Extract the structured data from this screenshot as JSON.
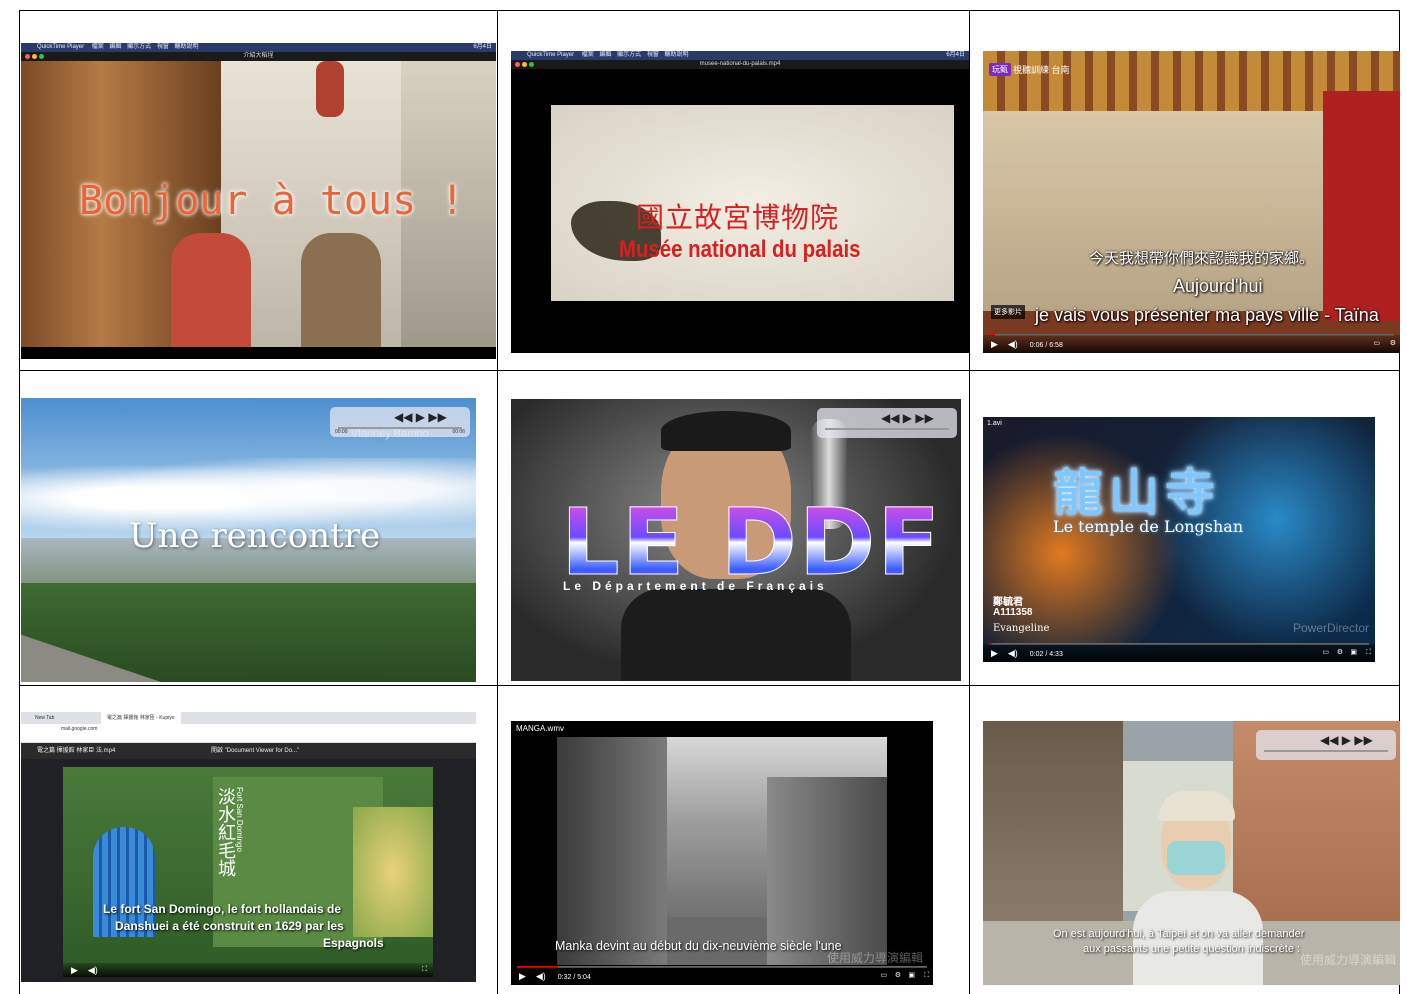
{
  "cells": [
    {
      "id": "bonjour",
      "app_title": "QuickTime Player",
      "window_title": "介紹大稻埕",
      "menu_items": [
        "檔案",
        "編輯",
        "顯示方式",
        "視窗",
        "輔助說明"
      ],
      "clock": "6月4日",
      "overlay_title": "Bonjour à tous !"
    },
    {
      "id": "palais",
      "app_title": "QuickTime Player",
      "window_title": "musee-national-du-palais.mp4",
      "menu_items": [
        "檔案",
        "編輯",
        "顯示方式",
        "視窗",
        "輔助說明"
      ],
      "clock": "6月4日",
      "title_zh": "國立故宮博物院",
      "title_fr": "Musée national du palais"
    },
    {
      "id": "tainan",
      "channel_badge": "玩甄",
      "channel_title": "視聽訓練 台南",
      "subtitle_zh": "今天我想帶你們來認識我的家鄉。",
      "subtitle_fr_1": "Aujourd'hui",
      "subtitle_fr_2": "je vais vous présenter ma pays ville - Taïna",
      "more_videos": "更多影片",
      "time": "0:06 / 6:58",
      "progress": 0.015
    },
    {
      "id": "rencontre",
      "title": "Une rencontre",
      "watermark": "Vlanney Bambo",
      "time_left": "00:00",
      "time_right": "00:06",
      "progress": 0.0
    },
    {
      "id": "ddf",
      "title": "LE DDF",
      "subtitle": "Le Département de Français"
    },
    {
      "id": "longshan",
      "file_label": "1.avi",
      "title_zh": "龍山寺",
      "title_fr": "Le temple de Longshan",
      "credit_1": "鄭毓君",
      "credit_2": "A111358",
      "credit_3": "Evangeline",
      "watermark": "PowerDirector",
      "time": "0:02 / 4:33",
      "progress": 0.007
    },
    {
      "id": "danshui",
      "browser_tab_1": "New Tab",
      "browser_tab_2": "電之篇 揮援館 林家臣 - Kupiyo",
      "url": "mail.google.com",
      "drive_file": "電之篇 揮援館 林家臣 法.mp4",
      "drive_open": "開啟 \"Document Viewer for Do...\"",
      "vertical_zh": "淡水紅毛城",
      "vertical_fr": "Fort San Domingo",
      "caption_1": "Le fort San Domingo, le fort hollandais de",
      "caption_2": "Danshuei a été construit en 1629 par les",
      "caption_3": "Espagnols"
    },
    {
      "id": "manga",
      "file_label": "MANGA.wmv",
      "caption": "Manka devint au début du dix-neuvième siècle l'une",
      "watermark": "使用威力導演編輯",
      "time": "0:32 / 5:04",
      "progress": 0.1
    },
    {
      "id": "street",
      "caption_1": "On est aujourd'hui, à Taipei et on va aller demander",
      "caption_2": "aux passants une petite question indiscrète :",
      "watermark": "使用威力導演編輯"
    }
  ],
  "colors": {
    "grid": "#000000",
    "progress": "#e00000",
    "bonjour_title": "#e8663a",
    "palais_title": "#d82020"
  }
}
